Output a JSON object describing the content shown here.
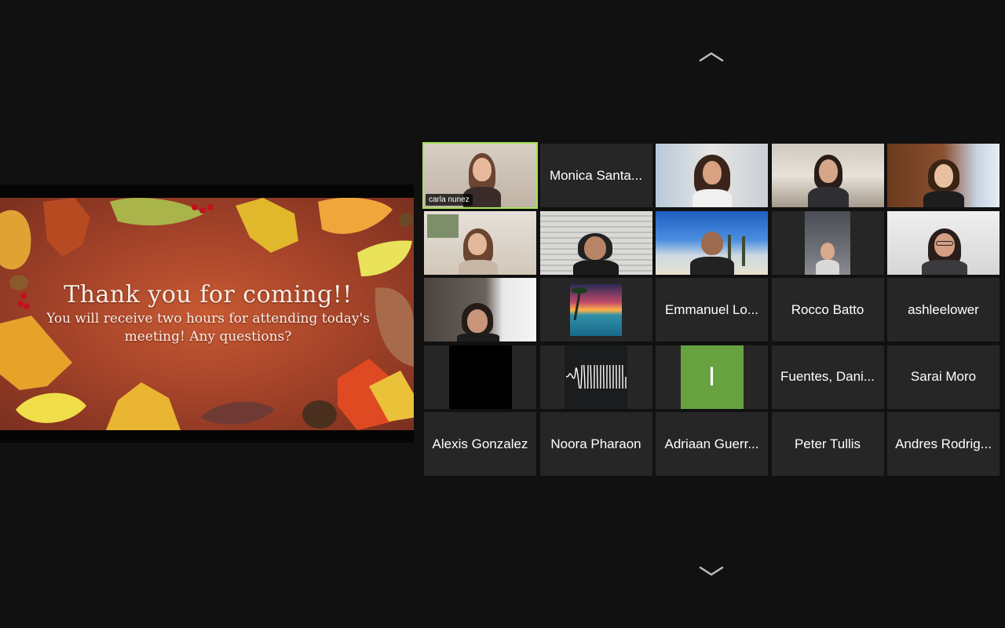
{
  "share": {
    "title": "Thank you for coming!!",
    "subtitle_line1": "You will receive two hours for attending today's",
    "subtitle_line2": "meeting! Any questions?"
  },
  "nav": {
    "up_icon": "chevron-up-icon",
    "down_icon": "chevron-down-icon"
  },
  "participants": [
    {
      "name": "carla nunez",
      "type": "video",
      "active": true
    },
    {
      "name": "Monica Santa...",
      "type": "name"
    },
    {
      "name": "",
      "type": "video"
    },
    {
      "name": "",
      "type": "video"
    },
    {
      "name": "",
      "type": "video"
    },
    {
      "name": "",
      "type": "video"
    },
    {
      "name": "",
      "type": "video"
    },
    {
      "name": "",
      "type": "video"
    },
    {
      "name": "",
      "type": "video"
    },
    {
      "name": "",
      "type": "video"
    },
    {
      "name": "",
      "type": "video"
    },
    {
      "name": "",
      "type": "image"
    },
    {
      "name": "Emmanuel Lo...",
      "type": "name"
    },
    {
      "name": "Rocco Batto",
      "type": "name"
    },
    {
      "name": "ashleelower",
      "type": "name"
    },
    {
      "name": "",
      "type": "black"
    },
    {
      "name": "",
      "type": "waveform"
    },
    {
      "name": "I",
      "type": "avatar",
      "color": "#67a140"
    },
    {
      "name": "Fuentes, Dani...",
      "type": "name"
    },
    {
      "name": "Sarai Moro",
      "type": "name"
    },
    {
      "name": "Alexis Gonzalez",
      "type": "name"
    },
    {
      "name": "Noora Pharaon",
      "type": "name"
    },
    {
      "name": "Adriaan Guerr...",
      "type": "name"
    },
    {
      "name": "Peter Tullis",
      "type": "name"
    },
    {
      "name": "Andres Rodrig...",
      "type": "name"
    }
  ],
  "colors": {
    "background": "#111111",
    "tile": "#262626",
    "active_speaker_border": "#a7e05a"
  }
}
